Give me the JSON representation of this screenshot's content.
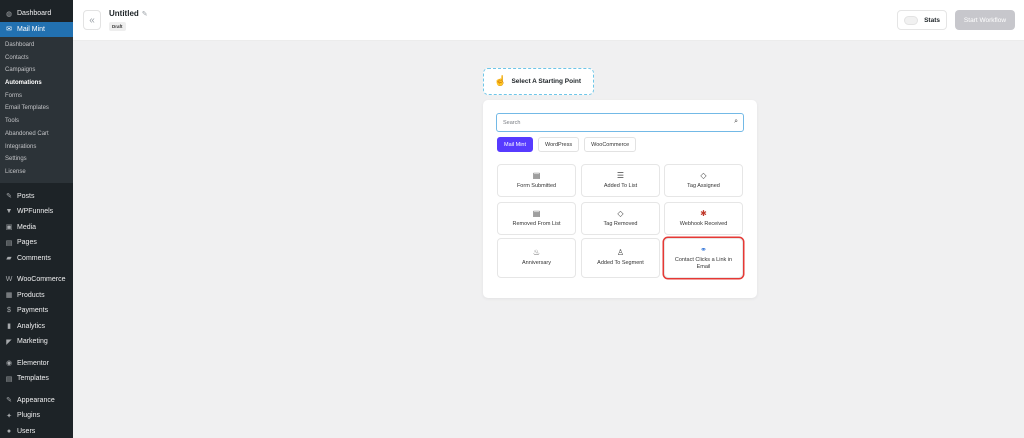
{
  "sidebar": {
    "top_items": [
      {
        "label": "Dashboard",
        "icon": "dashboard-icon",
        "glyph": "◍"
      },
      {
        "label": "Mail Mint",
        "icon": "mail-icon",
        "glyph": "✉"
      }
    ],
    "submenu": [
      "Dashboard",
      "Contacts",
      "Campaigns",
      "Automations",
      "Forms",
      "Email Templates",
      "Tools",
      "Abandoned Cart",
      "Integrations",
      "Settings",
      "License"
    ],
    "current_sub": "Automations",
    "bottom_groups": [
      [
        {
          "label": "Posts",
          "icon": "pin-icon",
          "glyph": "✎"
        },
        {
          "label": "WPFunnels",
          "icon": "funnel-icon",
          "glyph": "▼"
        },
        {
          "label": "Media",
          "icon": "media-icon",
          "glyph": "▣"
        },
        {
          "label": "Pages",
          "icon": "page-icon",
          "glyph": "▤"
        },
        {
          "label": "Comments",
          "icon": "comment-icon",
          "glyph": "▰"
        }
      ],
      [
        {
          "label": "WooCommerce",
          "icon": "woo-icon",
          "glyph": "W"
        },
        {
          "label": "Products",
          "icon": "products-icon",
          "glyph": "▦"
        },
        {
          "label": "Payments",
          "icon": "payments-icon",
          "glyph": "$"
        },
        {
          "label": "Analytics",
          "icon": "analytics-icon",
          "glyph": "▮"
        },
        {
          "label": "Marketing",
          "icon": "marketing-icon",
          "glyph": "◤"
        }
      ],
      [
        {
          "label": "Elementor",
          "icon": "elementor-icon",
          "glyph": "◉"
        },
        {
          "label": "Templates",
          "icon": "templates-icon",
          "glyph": "▤"
        }
      ],
      [
        {
          "label": "Appearance",
          "icon": "appearance-icon",
          "glyph": "✎"
        },
        {
          "label": "Plugins",
          "icon": "plugin-icon",
          "glyph": "✦"
        },
        {
          "label": "Users",
          "icon": "users-icon",
          "glyph": "●"
        }
      ]
    ]
  },
  "header": {
    "title": "Untitled",
    "status": "Draft",
    "stats_label": "Stats",
    "start_label": "Start Workflow"
  },
  "starting_point": {
    "label": "Select A Starting Point"
  },
  "panel": {
    "search_placeholder": "Search",
    "tabs": [
      "Mail Mint",
      "WordPress",
      "WooCommerce"
    ],
    "active_tab": "Mail Mint",
    "triggers": [
      {
        "label": "Form Submitted",
        "icon": "form-icon",
        "glyph": "▤"
      },
      {
        "label": "Added To List",
        "icon": "list-icon",
        "glyph": "☰"
      },
      {
        "label": "Tag Assigned",
        "icon": "tag-icon",
        "glyph": "◇"
      },
      {
        "label": "Removed From List",
        "icon": "list-remove-icon",
        "glyph": "▤"
      },
      {
        "label": "Tag Removed",
        "icon": "tag-remove-icon",
        "glyph": "◇"
      },
      {
        "label": "Webhook Received",
        "icon": "webhook-icon",
        "glyph": "✱"
      },
      {
        "label": "Anniversary",
        "icon": "cake-icon",
        "glyph": "♨"
      },
      {
        "label": "Added To Segment",
        "icon": "segment-icon",
        "glyph": "♙"
      },
      {
        "label": "Contact Clicks a Link in Email",
        "icon": "link-icon",
        "glyph": "⚭"
      }
    ],
    "highlighted": "Contact Clicks a Link in Email"
  },
  "colors": {
    "accent": "#573bff",
    "wp_blue": "#2271b1",
    "highlight": "#e53935"
  }
}
